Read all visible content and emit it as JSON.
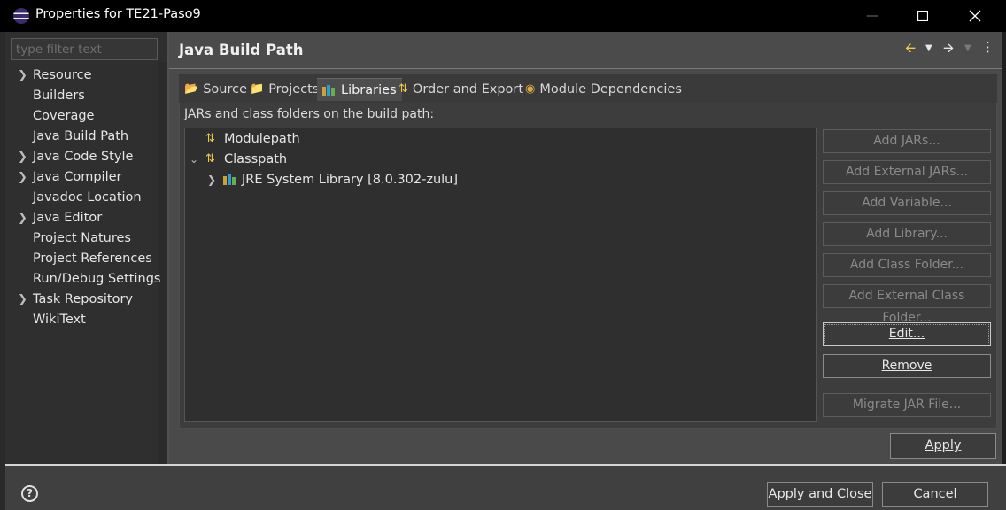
{
  "window": {
    "title": "Properties for TE21-Paso9",
    "minimize_glyph": "—",
    "maximize_glyph": "☐",
    "close_glyph": "✕"
  },
  "filter": {
    "placeholder": "type filter text",
    "value": ""
  },
  "sidebar": {
    "items": [
      {
        "label": "Resource",
        "expandable": true
      },
      {
        "label": "Builders",
        "expandable": false
      },
      {
        "label": "Coverage",
        "expandable": false
      },
      {
        "label": "Java Build Path",
        "expandable": false,
        "selected": true
      },
      {
        "label": "Java Code Style",
        "expandable": true
      },
      {
        "label": "Java Compiler",
        "expandable": true
      },
      {
        "label": "Javadoc Location",
        "expandable": false
      },
      {
        "label": "Java Editor",
        "expandable": true
      },
      {
        "label": "Project Natures",
        "expandable": false
      },
      {
        "label": "Project References",
        "expandable": false
      },
      {
        "label": "Run/Debug Settings",
        "expandable": false
      },
      {
        "label": "Task Repository",
        "expandable": true
      },
      {
        "label": "WikiText",
        "expandable": false
      }
    ]
  },
  "header": {
    "title": "Java Build Path",
    "icons": [
      "back-arrow-icon",
      "dropdown-icon",
      "forward-arrow-icon",
      "dropdown-icon",
      "view-menu-icon"
    ]
  },
  "tabs": [
    {
      "label": "Source",
      "icon": "source-folder-icon"
    },
    {
      "label": "Projects",
      "icon": "projects-folder-icon"
    },
    {
      "label": "Libraries",
      "icon": "libraries-icon",
      "active": true
    },
    {
      "label": "Order and Export",
      "icon": "order-export-icon"
    },
    {
      "label": "Module Dependencies",
      "icon": "module-icon"
    }
  ],
  "libraries": {
    "description": "JARs and class folders on the build path:",
    "tree": [
      {
        "label": "Modulepath",
        "expanded": false
      },
      {
        "label": "Classpath",
        "expanded": true
      },
      {
        "label": "JRE System Library [8.0.302-zulu]",
        "expanded": false
      }
    ]
  },
  "side_buttons": {
    "add_jars": "Add JARs...",
    "add_external_jars": "Add External JARs...",
    "add_variable": "Add Variable...",
    "add_library": "Add Library...",
    "add_class_folder": "Add Class Folder...",
    "add_external_class_folder": "Add External Class Folder...",
    "edit": "Edit...",
    "remove": "Remove",
    "migrate_jar": "Migrate JAR File..."
  },
  "buttons": {
    "apply": "Apply",
    "apply_and_close": "Apply and Close",
    "cancel": "Cancel",
    "help": "?"
  },
  "colors": {
    "accent_icon": "#f0c845",
    "background": "#4a4a4a",
    "tree_background": "#2f2f2f"
  }
}
